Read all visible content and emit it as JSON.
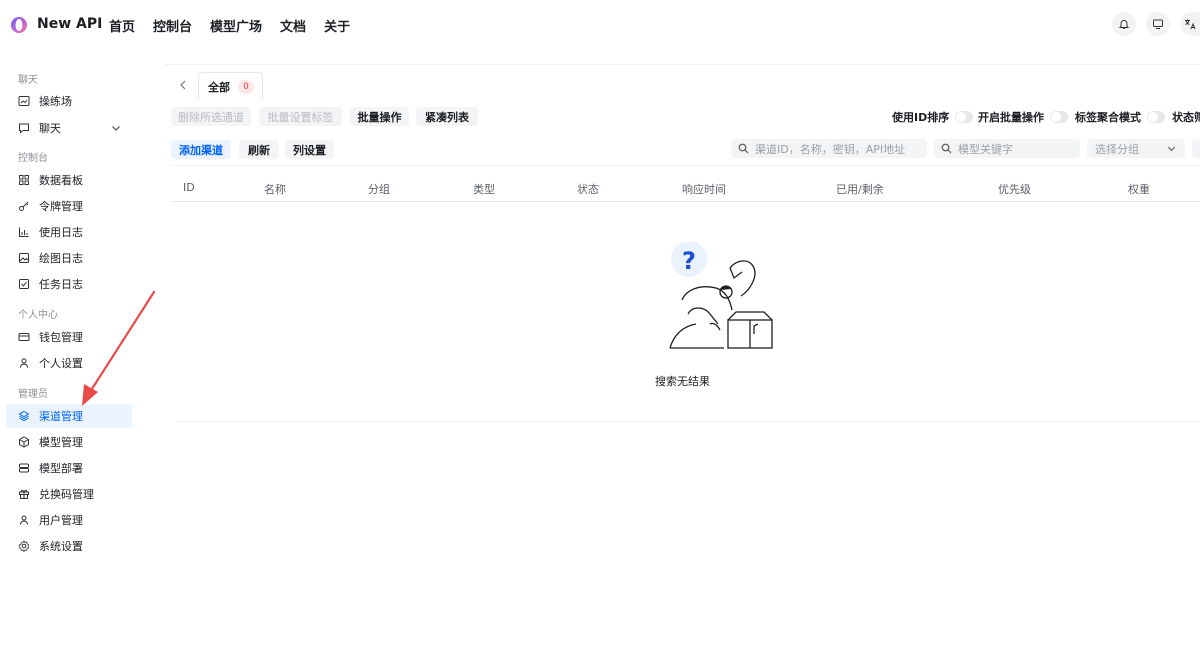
{
  "brand": {
    "name": "New API"
  },
  "nav": [
    "首页",
    "控制台",
    "模型广场",
    "文档",
    "关于"
  ],
  "sidebar": {
    "sections": [
      {
        "title": "聊天",
        "items": [
          {
            "label": "操练场",
            "icon": "playground-icon"
          },
          {
            "label": "聊天",
            "icon": "chat-icon"
          }
        ]
      },
      {
        "title": "控制台",
        "items": [
          {
            "label": "数据看板",
            "icon": "dashboard-icon"
          },
          {
            "label": "令牌管理",
            "icon": "key-icon"
          },
          {
            "label": "使用日志",
            "icon": "bar-chart-icon"
          },
          {
            "label": "绘图日志",
            "icon": "image-icon"
          },
          {
            "label": "任务日志",
            "icon": "checkbox-icon"
          }
        ]
      },
      {
        "title": "个人中心",
        "items": [
          {
            "label": "钱包管理",
            "icon": "wallet-icon"
          },
          {
            "label": "个人设置",
            "icon": "user-icon"
          }
        ]
      },
      {
        "title": "管理员",
        "items": [
          {
            "label": "渠道管理",
            "icon": "layers-icon",
            "active": true
          },
          {
            "label": "模型管理",
            "icon": "cube-icon"
          },
          {
            "label": "模型部署",
            "icon": "server-icon"
          },
          {
            "label": "兑换码管理",
            "icon": "gift-icon"
          },
          {
            "label": "用户管理",
            "icon": "user-icon"
          },
          {
            "label": "系统设置",
            "icon": "gear-icon"
          }
        ]
      }
    ]
  },
  "tabs": {
    "all_label": "全部",
    "all_count": "0"
  },
  "toolbar": {
    "delete_selected": "删除所选通道",
    "batch_tag": "批量设置标签",
    "batch_ops": "批量操作",
    "compact_list": "紧凑列表",
    "add_channel": "添加渠道",
    "refresh": "刷新",
    "column_settings": "列设置"
  },
  "switches": {
    "sort_by_id": "使用ID排序",
    "batch_mode": "开启批量操作",
    "tag_mode": "标签聚合模式",
    "status": "状态筛"
  },
  "search": {
    "channel_placeholder": "渠道ID，名称，密钥，API地址",
    "model_placeholder": "模型关键字",
    "group_placeholder": "选择分组"
  },
  "table": {
    "columns": [
      "ID",
      "名称",
      "分组",
      "类型",
      "状态",
      "响应时间",
      "已用/剩余",
      "优先级",
      "权重"
    ],
    "empty_text": "搜索无结果"
  },
  "colors": {
    "accent": "#0064fa",
    "annotation_arrow": "#e84a4a"
  }
}
